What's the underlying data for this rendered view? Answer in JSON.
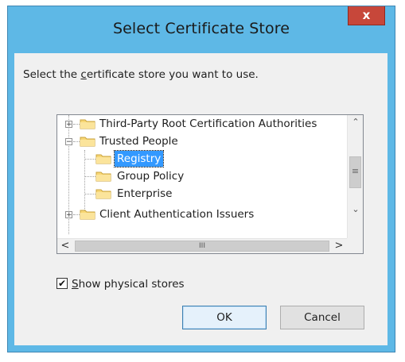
{
  "window": {
    "title": "Select Certificate Store",
    "close_glyph": "x",
    "frame_color": "#5eb8e6",
    "close_color": "#c7473a"
  },
  "prompt": {
    "before": "Select the ",
    "mnemonic": "c",
    "after": "ertificate store you want to use."
  },
  "tree": {
    "items": [
      {
        "label": "Third-Party Root Certification Authorities",
        "expander": "+",
        "level": 0
      },
      {
        "label": "Trusted People",
        "expander": "−",
        "level": 0
      },
      {
        "label": "Registry",
        "level": 1,
        "selected": true
      },
      {
        "label": "Group Policy",
        "level": 1
      },
      {
        "label": "Enterprise",
        "level": 1
      },
      {
        "label": "Client Authentication Issuers",
        "expander": "+",
        "level": 0
      }
    ],
    "selection_color": "#3399ff"
  },
  "scrollbars": {
    "up": "⌃",
    "down": "⌄",
    "left": "<",
    "right": ">",
    "grip_v": "≡",
    "grip_h": "III"
  },
  "checkbox": {
    "checked": true,
    "check_glyph": "✔",
    "mnemonic": "S",
    "label_rest": "how physical stores"
  },
  "buttons": {
    "ok": "OK",
    "cancel": "Cancel"
  }
}
